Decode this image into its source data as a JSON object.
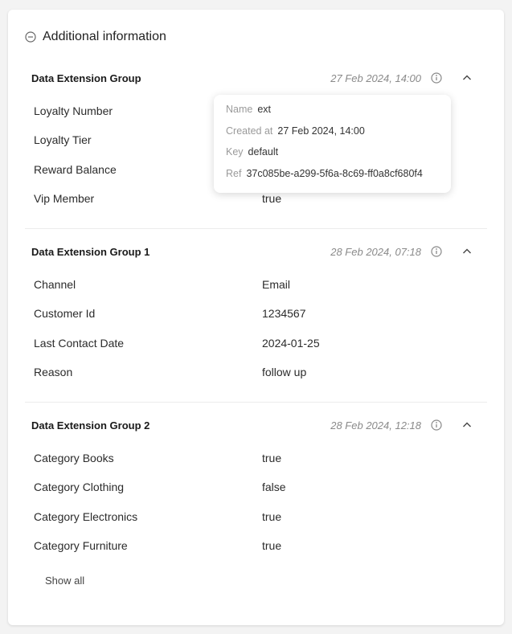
{
  "panel": {
    "title": "Additional information"
  },
  "groups": [
    {
      "name": "Data Extension Group",
      "date": "27 Feb 2024, 14:00",
      "rows": [
        {
          "key": "Loyalty Number",
          "value": ""
        },
        {
          "key": "Loyalty Tier",
          "value": ""
        },
        {
          "key": "Reward Balance",
          "value": ""
        },
        {
          "key": "Vip Member",
          "value": "true"
        }
      ]
    },
    {
      "name": "Data Extension Group 1",
      "date": "28 Feb 2024, 07:18",
      "rows": [
        {
          "key": "Channel",
          "value": "Email"
        },
        {
          "key": "Customer Id",
          "value": "1234567"
        },
        {
          "key": "Last Contact Date",
          "value": "2024-01-25"
        },
        {
          "key": "Reason",
          "value": "follow up"
        }
      ]
    },
    {
      "name": "Data Extension Group 2",
      "date": "28 Feb 2024, 12:18",
      "rows": [
        {
          "key": "Category Books",
          "value": "true"
        },
        {
          "key": "Category Clothing",
          "value": "false"
        },
        {
          "key": "Category Electronics",
          "value": "true"
        },
        {
          "key": "Category Furniture",
          "value": "true"
        }
      ]
    }
  ],
  "show_all_label": "Show all",
  "tooltip": {
    "name_label": "Name",
    "name_value": "ext",
    "created_label": "Created at",
    "created_value": "27 Feb 2024, 14:00",
    "key_label": "Key",
    "key_value": "default",
    "ref_label": "Ref",
    "ref_value": "37c085be-a299-5f6a-8c69-ff0a8cf680f4"
  },
  "icons": {
    "collapse": "minus-circle-icon",
    "info": "info-circle-icon",
    "chevron": "chevron-up-icon"
  }
}
